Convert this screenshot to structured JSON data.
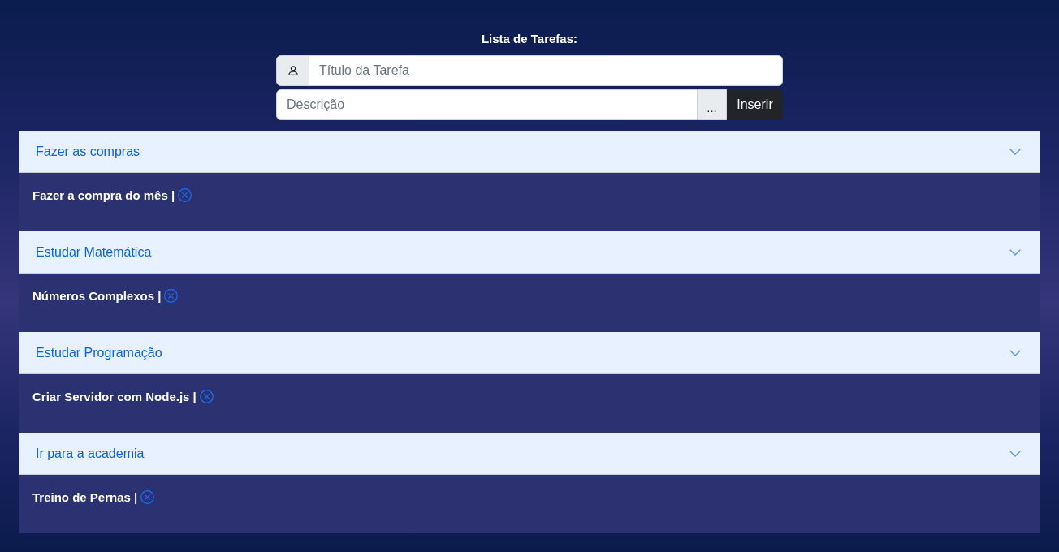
{
  "title": "Lista de Tarefas:",
  "form": {
    "title_field": {
      "placeholder": "Título da Tarefa"
    },
    "description_field": {
      "placeholder": "Descrição"
    },
    "addon": "...",
    "submit_button": "Inserir"
  },
  "tasks": [
    {
      "title": "Fazer as compras",
      "expanded": true,
      "description": "Fazer a compra do mês |"
    },
    {
      "title": "Estudar Matemática",
      "expanded": true,
      "description": "Números Complexos |"
    },
    {
      "title": "Estudar Programação",
      "expanded": true,
      "description": "Criar Servidor com Node.js |"
    },
    {
      "title": "Ir para a academia",
      "expanded": true,
      "description": "Treino de Pernas |"
    }
  ]
}
